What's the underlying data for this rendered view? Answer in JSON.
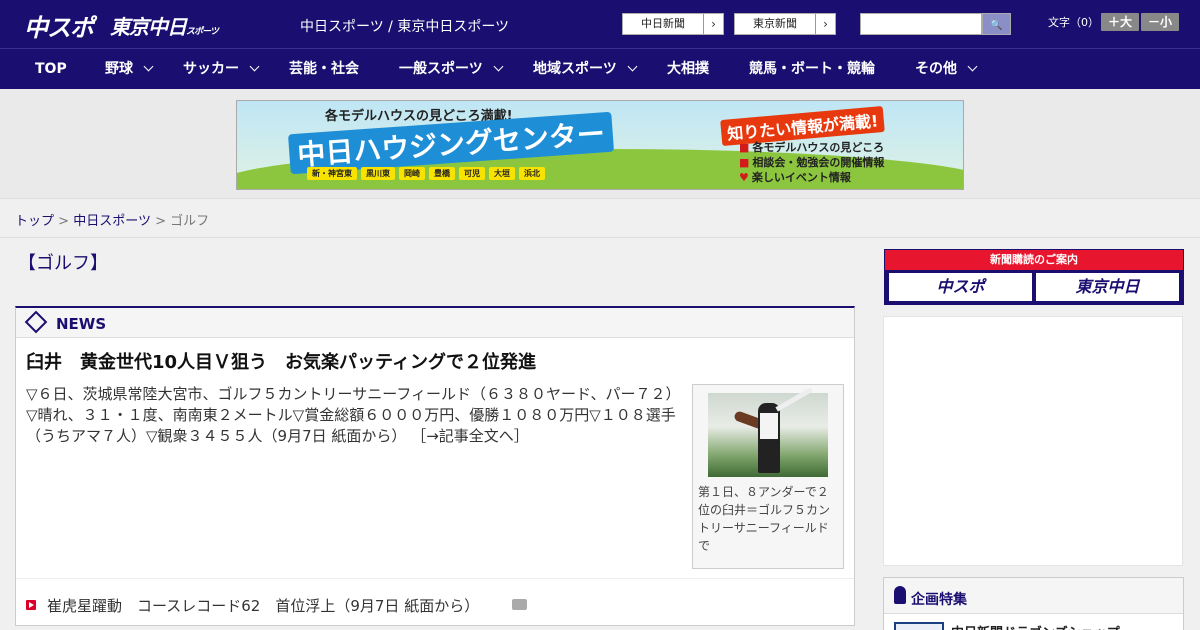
{
  "header": {
    "logo_chuspo": "中スポ",
    "logo_tokyo": "東京中日",
    "logo_tokyo_small": "スポーツ",
    "site_title": "中日スポーツ / 東京中日スポーツ",
    "ext_links": [
      {
        "label": "中日新聞",
        "arrow": "›"
      },
      {
        "label": "東京新聞",
        "arrow": "›"
      }
    ],
    "search_placeholder": "",
    "search_icon": "🔍",
    "font_size_label": "文字（0）",
    "font_larger": "＋大",
    "font_smaller": "－小"
  },
  "nav": {
    "items": [
      {
        "label": "TOP",
        "has_dropdown": false
      },
      {
        "label": "野球",
        "has_dropdown": true
      },
      {
        "label": "サッカー",
        "has_dropdown": true
      },
      {
        "label": "芸能・社会",
        "has_dropdown": false
      },
      {
        "label": "一般スポーツ",
        "has_dropdown": true
      },
      {
        "label": "地域スポーツ",
        "has_dropdown": true
      },
      {
        "label": "大相撲",
        "has_dropdown": false
      },
      {
        "label": "競馬・ボート・競輪",
        "has_dropdown": false
      },
      {
        "label": "その他",
        "has_dropdown": true
      }
    ]
  },
  "banner": {
    "subtitle": "各モデルハウスの見どころ満載!",
    "title": "中日ハウジングセンター",
    "locations": [
      "新・神宮東",
      "黒川東",
      "岡崎",
      "豊橋",
      "可児",
      "大垣",
      "浜北"
    ],
    "right_title": "知りたい情報が満載!",
    "features": [
      "各モデルハウスの見どころ",
      "相談会・勉強会の開催情報",
      "楽しいイベント情報"
    ]
  },
  "breadcrumb": {
    "home": "トップ",
    "section": "中日スポーツ",
    "sep": ">",
    "current": "ゴルフ"
  },
  "page_title": "【ゴルフ】",
  "news": {
    "heading": "NEWS",
    "headline": "臼井　黄金世代10人目Ｖ狙う　お気楽パッティングで２位発進",
    "summary": "▽６日、茨城県常陸大宮市、ゴルフ５カントリーサニーフィールド（６３８０ヤード、パー７２）▽晴れ、３１・１度、南南東２メートル▽賞金総額６０００万円、優勝１０８０万円▽１０８選手（うちアマ７人）▽観衆３４５５人（9月7日 紙面から）",
    "more_link": "［→記事全文へ］",
    "photo_caption": "第１日、８アンダーで２位の臼井＝ゴルフ５カントリーサニーフィールドで",
    "items": [
      {
        "title": "崔虎星躍動　コースレコード62　首位浮上（9月7日 紙面から）",
        "has_photo": true
      }
    ]
  },
  "sidebar": {
    "subscribe_label": "新聞購読のご案内",
    "subscribe_logos": [
      "中スポ",
      "東京中日"
    ],
    "feature_title": "企画特集",
    "feature_item": "中日新聞ドラゴンズショップ"
  },
  "colors": {
    "brand_navy": "#1a0f70",
    "accent_red": "#e8152e"
  }
}
